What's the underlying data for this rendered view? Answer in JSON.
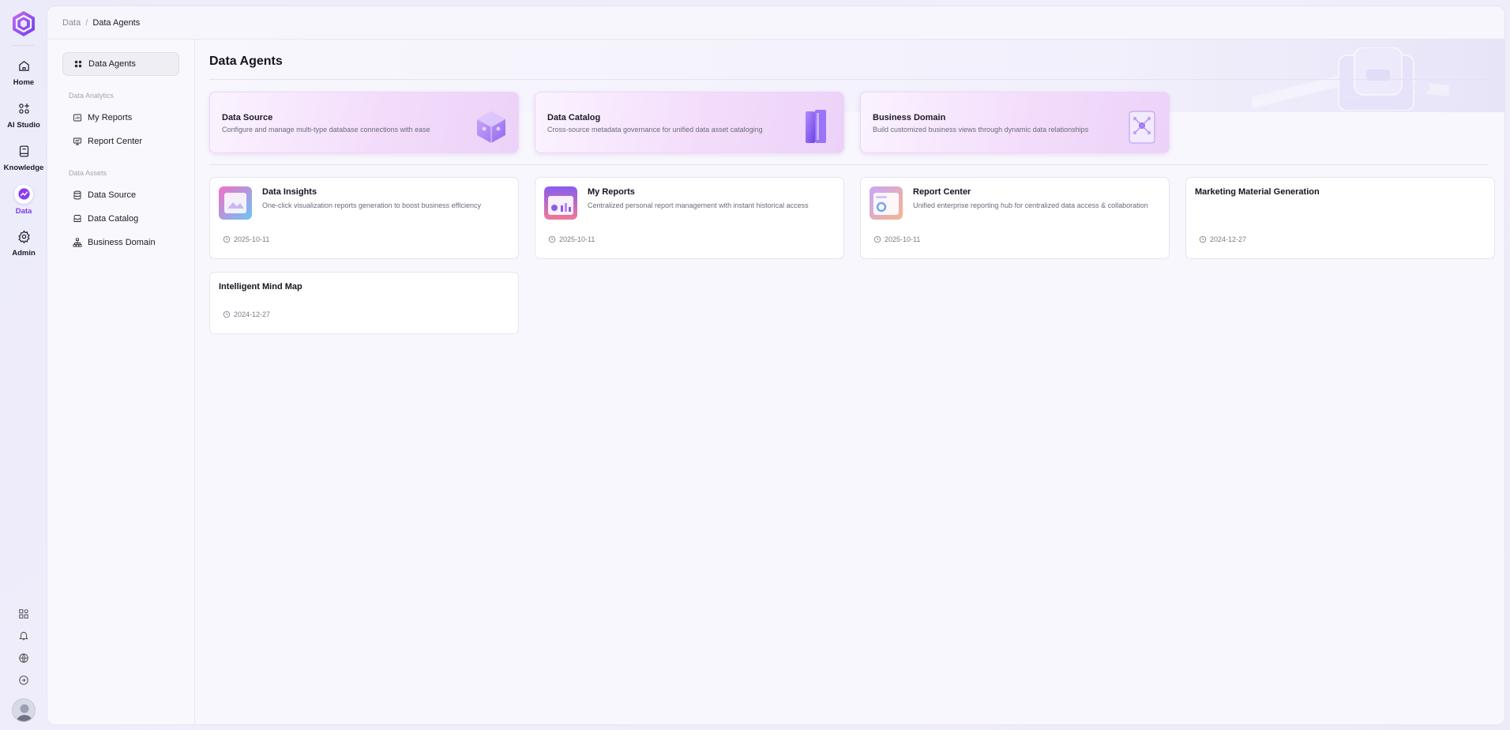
{
  "rail": {
    "items": [
      {
        "label": "Home",
        "icon": "home-icon"
      },
      {
        "label": "AI Studio",
        "icon": "grid-plus-icon"
      },
      {
        "label": "Knowledge",
        "icon": "book-icon"
      },
      {
        "label": "Data",
        "icon": "chart-icon"
      },
      {
        "label": "Admin",
        "icon": "gear-icon"
      }
    ],
    "active": "Data",
    "bottom_icons": [
      "apps-icon",
      "bell-icon",
      "globe-icon",
      "logout-icon"
    ]
  },
  "breadcrumb": {
    "parent": "Data",
    "separator": "/",
    "current": "Data Agents"
  },
  "sidebar": {
    "top_item": "Data Agents",
    "groups": [
      {
        "label": "Data Analytics",
        "items": [
          "My Reports",
          "Report Center"
        ]
      },
      {
        "label": "Data Assets",
        "items": [
          "Data Source",
          "Data Catalog",
          "Business Domain"
        ]
      }
    ]
  },
  "main": {
    "title": "Data Agents",
    "featured": [
      {
        "title": "Data Source",
        "description": "Configure and manage multi-type database connections with ease"
      },
      {
        "title": "Data Catalog",
        "description": "Cross-source metadata governance for unified data asset cataloging"
      },
      {
        "title": "Business Domain",
        "description": "Build customized business views through dynamic data relationships"
      }
    ],
    "agents": [
      {
        "title": "Data Insights",
        "description": "One-click visualization reports generation to boost business efficiency",
        "date": "2025-10-11"
      },
      {
        "title": "My Reports",
        "description": "Centralized personal report management with instant historical access",
        "date": "2025-10-11"
      },
      {
        "title": "Report Center",
        "description": "Unified enterprise reporting hub for centralized data access & collaboration",
        "date": "2025-10-11"
      },
      {
        "title": "Marketing Material Generation",
        "description": "",
        "date": "2024-12-27"
      },
      {
        "title": "Intelligent Mind Map",
        "description": "",
        "date": "2024-12-27"
      }
    ]
  },
  "colors": {
    "accent": "#7a3cf0",
    "panel": "#f8f7fd",
    "card": "#ffffff",
    "featured_gradient_end": "#ecd2f8"
  }
}
